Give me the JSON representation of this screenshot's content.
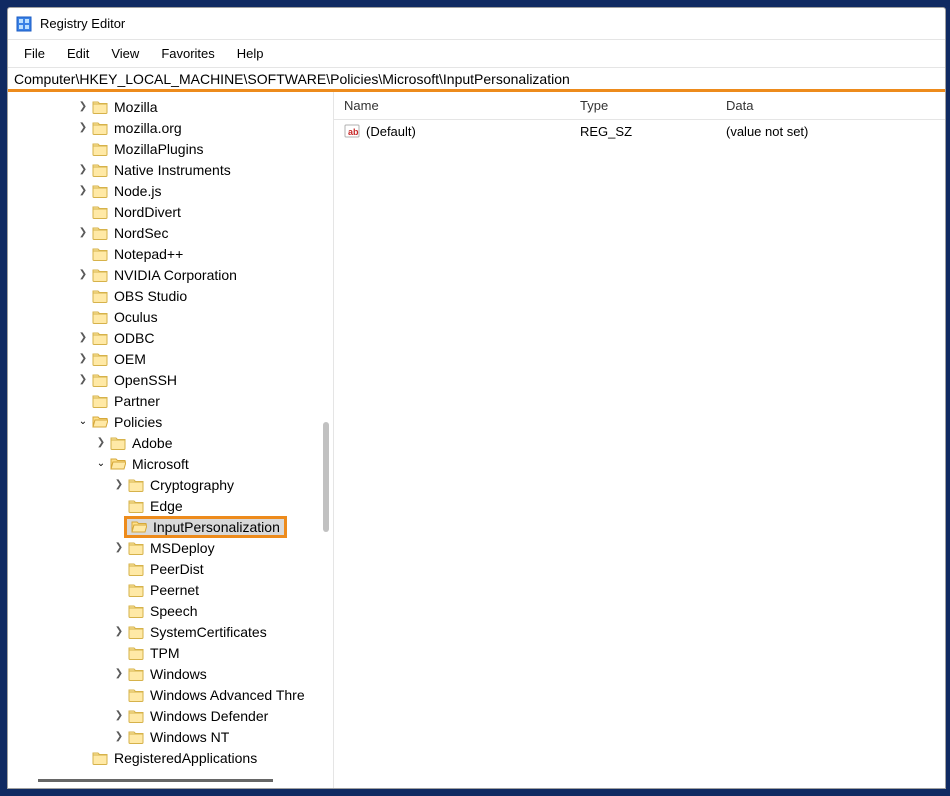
{
  "window": {
    "title": "Registry Editor"
  },
  "menu": {
    "file": "File",
    "edit": "Edit",
    "view": "View",
    "favorites": "Favorites",
    "help": "Help"
  },
  "address": {
    "path": "Computer\\HKEY_LOCAL_MACHINE\\SOFTWARE\\Policies\\Microsoft\\InputPersonalization"
  },
  "columns": {
    "name": "Name",
    "type": "Type",
    "data": "Data"
  },
  "values": [
    {
      "name": "(Default)",
      "type": "REG_SZ",
      "data": "(value not set)"
    }
  ],
  "tree": {
    "mozilla": "Mozilla",
    "mozilla_org": "mozilla.org",
    "mozilla_plugins": "MozillaPlugins",
    "native_instruments": "Native Instruments",
    "nodejs": "Node.js",
    "norddivert": "NordDivert",
    "nordsec": "NordSec",
    "notepadpp": "Notepad++",
    "nvidia": "NVIDIA Corporation",
    "obs": "OBS Studio",
    "oculus": "Oculus",
    "odbc": "ODBC",
    "oem": "OEM",
    "openssh": "OpenSSH",
    "partner": "Partner",
    "policies": "Policies",
    "adobe": "Adobe",
    "microsoft": "Microsoft",
    "cryptography": "Cryptography",
    "edge": "Edge",
    "inputpersonalization": "InputPersonalization",
    "msdeploy": "MSDeploy",
    "peerdist": "PeerDist",
    "peernet": "Peernet",
    "speech": "Speech",
    "system_certs": "SystemCertificates",
    "tpm": "TPM",
    "windows": "Windows",
    "windows_adv": "Windows Advanced Thre",
    "windows_defender": "Windows Defender",
    "windows_nt": "Windows NT",
    "registered_apps": "RegisteredApplications"
  }
}
